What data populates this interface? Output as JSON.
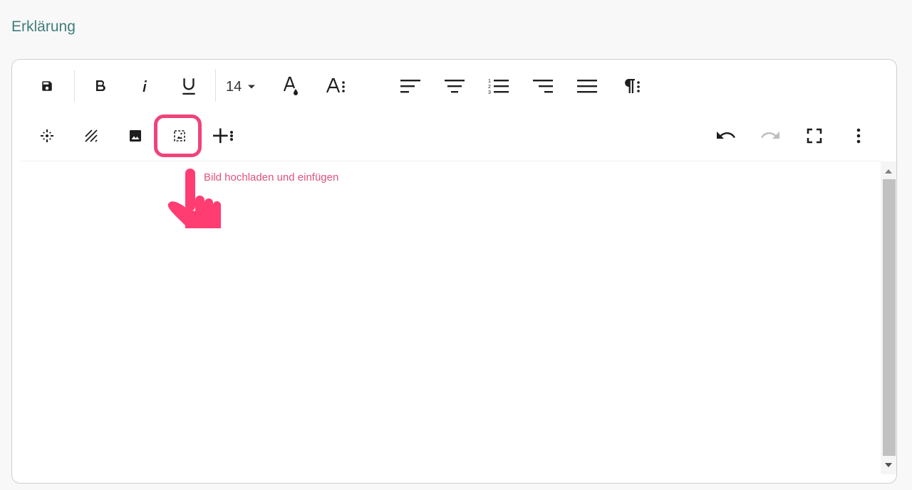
{
  "field": {
    "label": "Erklärung"
  },
  "toolbar": {
    "font_size": "14",
    "buttons": [
      {
        "name": "save",
        "icon": "save-icon"
      },
      {
        "name": "bold",
        "icon": "bold-icon"
      },
      {
        "name": "italic",
        "icon": "italic-icon"
      },
      {
        "name": "underline",
        "icon": "underline-icon"
      },
      {
        "name": "text-color",
        "icon": "text-color-icon"
      },
      {
        "name": "font-options",
        "icon": "font-more-icon"
      },
      {
        "name": "align-left",
        "icon": "align-left-icon"
      },
      {
        "name": "align-center",
        "icon": "align-center-icon"
      },
      {
        "name": "ordered-list",
        "icon": "ordered-list-icon"
      },
      {
        "name": "align-right",
        "icon": "align-right-icon"
      },
      {
        "name": "justify",
        "icon": "justify-icon"
      },
      {
        "name": "paragraph",
        "icon": "paragraph-icon"
      },
      {
        "name": "select-all",
        "icon": "select-all-icon"
      },
      {
        "name": "clear-formatting",
        "icon": "clear-formatting-icon"
      },
      {
        "name": "insert-image",
        "icon": "image-icon"
      },
      {
        "name": "upload-image",
        "icon": "upload-image-icon"
      },
      {
        "name": "insert-more",
        "icon": "plus-more-icon"
      },
      {
        "name": "undo",
        "icon": "undo-icon"
      },
      {
        "name": "redo",
        "icon": "redo-icon"
      },
      {
        "name": "fullscreen",
        "icon": "fullscreen-icon"
      },
      {
        "name": "more-options",
        "icon": "more-vertical-icon"
      }
    ]
  },
  "tooltip": {
    "text": "Bild hochladen und einfügen"
  },
  "colors": {
    "label": "#3f7d7a",
    "highlight": "#f0437a",
    "tooltip": "#e0527d",
    "icon": "#1e1e1e",
    "icon_disabled": "#bdbdbd"
  }
}
